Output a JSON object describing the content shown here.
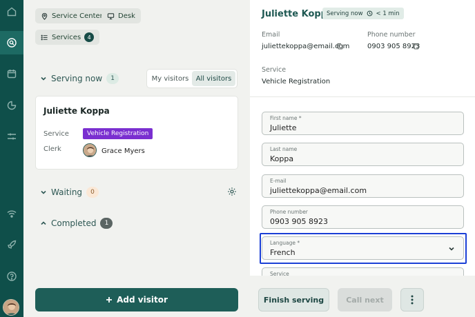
{
  "rail": {
    "icons": [
      "home-icon",
      "chat-search-icon",
      "calendar-icon",
      "chart-pie-icon",
      "sliders-icon",
      "wifi-icon",
      "rocket-icon",
      "help-icon"
    ]
  },
  "left": {
    "location_chip": "Service Center",
    "desk_chip": "Desk",
    "services_chip": "Services",
    "services_count": "4",
    "serving_now": {
      "title": "Serving now",
      "count": "1"
    },
    "visitor_toggle": {
      "mine": "My visitors",
      "all": "All visitors"
    },
    "card": {
      "name": "Juliette Koppa",
      "service_label": "Service",
      "service_tag": "Vehicle Registration",
      "clerk_label": "Clerk",
      "clerk_name": "Grace Myers"
    },
    "waiting": {
      "title": "Waiting",
      "count": "0"
    },
    "completed": {
      "title": "Completed",
      "count": "1"
    },
    "add_visitor": "Add visitor"
  },
  "right": {
    "name": "Juliette Koppa",
    "status": "Serving now",
    "time": "< 1 min",
    "email_label": "Email",
    "email": "juliettekoppa@email.com",
    "phone_label": "Phone number",
    "phone": "0903 905 8923",
    "service_label": "Service",
    "service": "Vehicle Registration",
    "form": {
      "first_name": {
        "label": "First name *",
        "value": "Juliette"
      },
      "last_name": {
        "label": "Last name",
        "value": "Koppa"
      },
      "email": {
        "label": "E-mail",
        "value": "juliettekoppa@email.com"
      },
      "phone": {
        "label": "Phone number",
        "value": "0903 905 8923"
      },
      "language": {
        "label": "Language *",
        "value": "French"
      },
      "service": {
        "label": "Service"
      }
    },
    "finish": "Finish serving",
    "call_next": "Call next"
  },
  "colors": {
    "rail": "#0f4f4a",
    "accent": "#1e5e58",
    "tag": "#7a2fd0",
    "focus": "#1a3fd6"
  }
}
